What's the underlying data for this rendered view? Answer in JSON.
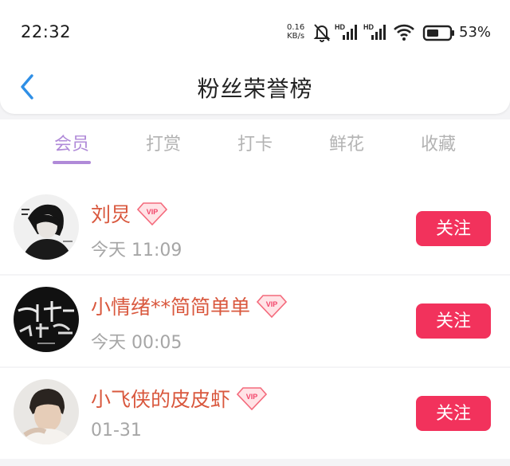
{
  "status_bar": {
    "time": "22:32",
    "net_speed": "0.16",
    "net_unit": "KB/s",
    "hd1": "HD",
    "hd2": "HD",
    "battery": "53%"
  },
  "header": {
    "title": "粉丝荣誉榜"
  },
  "tabs": [
    {
      "label": "会员",
      "active": true
    },
    {
      "label": "打赏",
      "active": false
    },
    {
      "label": "打卡",
      "active": false
    },
    {
      "label": "鲜花",
      "active": false
    },
    {
      "label": "收藏",
      "active": false
    }
  ],
  "vip_badge": "VIP",
  "fans": [
    {
      "name": "刘炅",
      "time": "今天 11:09",
      "button": "关注"
    },
    {
      "name": "小情绪**简简单单",
      "time": "今天 00:05",
      "button": "关注"
    },
    {
      "name": "小飞侠的皮皮虾",
      "time": "01-31",
      "button": "关注"
    }
  ],
  "colors": {
    "accent_tab": "#b08ad8",
    "name": "#d9583e",
    "button": "#f2325c",
    "back": "#2f8fe6"
  }
}
